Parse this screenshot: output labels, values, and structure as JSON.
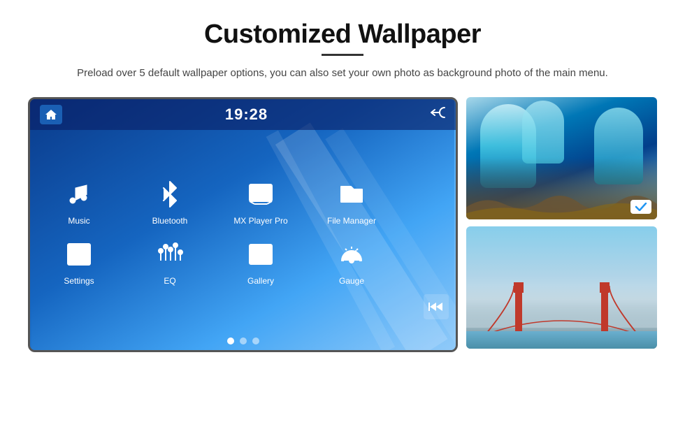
{
  "header": {
    "title": "Customized Wallpaper",
    "subtitle": "Preload over 5 default wallpaper options, you can also set your own photo as background photo of the main menu."
  },
  "car_screen": {
    "time": "19:28",
    "apps_row1": [
      {
        "id": "music",
        "label": "Music",
        "icon": "music-note"
      },
      {
        "id": "bluetooth",
        "label": "Bluetooth",
        "icon": "bluetooth"
      },
      {
        "id": "mx-player",
        "label": "MX Player Pro",
        "icon": "video-player"
      },
      {
        "id": "file-manager",
        "label": "File Manager",
        "icon": "folder"
      }
    ],
    "apps_row2": [
      {
        "id": "settings",
        "label": "Settings",
        "icon": "settings"
      },
      {
        "id": "eq",
        "label": "EQ",
        "icon": "equalizer"
      },
      {
        "id": "gallery",
        "label": "Gallery",
        "icon": "gallery"
      },
      {
        "id": "gauge",
        "label": "Gauge",
        "icon": "gauge"
      }
    ],
    "dots": [
      true,
      false,
      false
    ]
  },
  "images": {
    "top_alt": "Ice cave wallpaper",
    "bottom_alt": "Golden Gate Bridge wallpaper"
  }
}
